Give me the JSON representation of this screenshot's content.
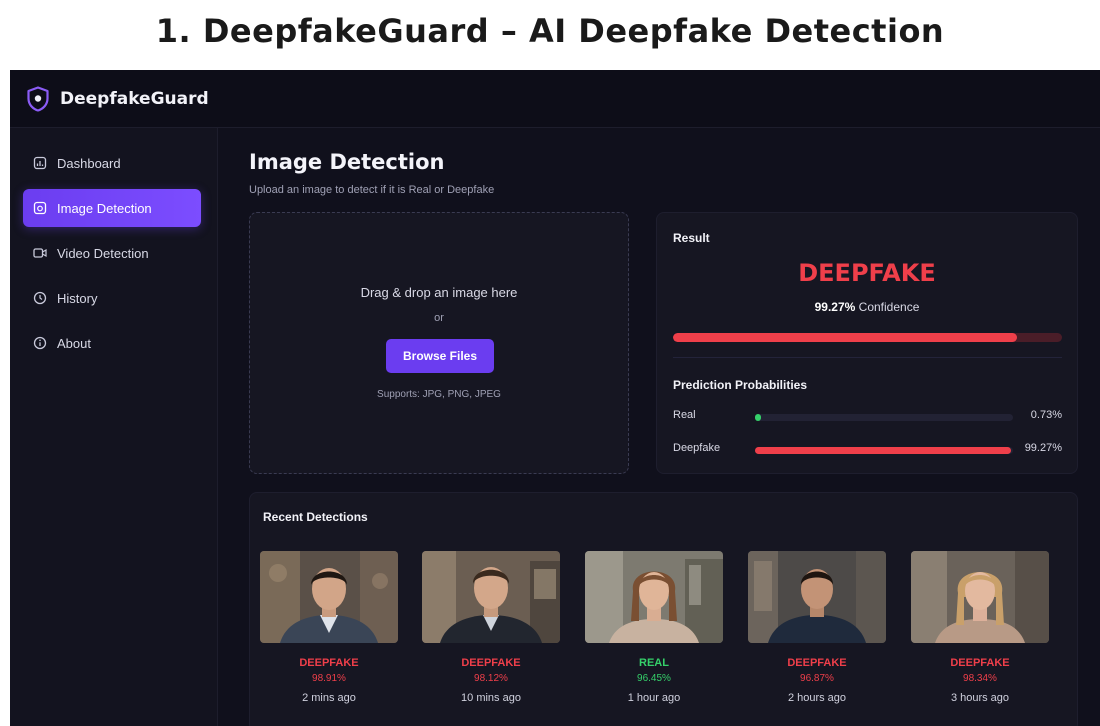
{
  "caption": "1. DeepfakeGuard – AI Deepfake Detection",
  "app": {
    "brand": "DeepfakeGuard"
  },
  "colors": {
    "accent": "#6b3df0",
    "fake": "#ef3f4a",
    "real": "#35d06a"
  },
  "sidebar": {
    "items": [
      {
        "label": "Dashboard",
        "icon": "dashboard-icon",
        "active": false
      },
      {
        "label": "Image Detection",
        "icon": "image-icon",
        "active": true
      },
      {
        "label": "Video Detection",
        "icon": "video-icon",
        "active": false
      },
      {
        "label": "History",
        "icon": "history-icon",
        "active": false
      },
      {
        "label": "About",
        "icon": "info-icon",
        "active": false
      }
    ]
  },
  "main": {
    "title": "Image Detection",
    "subtitle": "Upload an image to detect if it is Real or Deepfake",
    "upload": {
      "prompt": "Drag & drop an image here",
      "or": "or",
      "button": "Browse Files",
      "supports": "Supports: JPG, PNG, JPEG"
    },
    "result": {
      "label": "Result",
      "verdict": "DEEPFAKE",
      "confidence_value": "99.27%",
      "confidence_word": "Confidence",
      "confidence_fraction": 0.9927,
      "probabilities_title": "Prediction Probabilities",
      "probabilities": [
        {
          "name": "Real",
          "pct": "0.73%",
          "fraction": 0.0073,
          "color": "#35d06a"
        },
        {
          "name": "Deepfake",
          "pct": "99.27%",
          "fraction": 0.9927,
          "color": "#ef3f4a"
        }
      ]
    },
    "recent": {
      "title": "Recent Detections",
      "items": [
        {
          "label": "DEEPFAKE",
          "pct": "98.91%",
          "time": "2 mins ago",
          "status": "fake"
        },
        {
          "label": "DEEPFAKE",
          "pct": "98.12%",
          "time": "10 mins ago",
          "status": "fake"
        },
        {
          "label": "REAL",
          "pct": "96.45%",
          "time": "1 hour ago",
          "status": "real"
        },
        {
          "label": "DEEPFAKE",
          "pct": "96.87%",
          "time": "2 hours ago",
          "status": "fake"
        },
        {
          "label": "DEEPFAKE",
          "pct": "98.34%",
          "time": "3 hours ago",
          "status": "fake"
        }
      ]
    }
  }
}
